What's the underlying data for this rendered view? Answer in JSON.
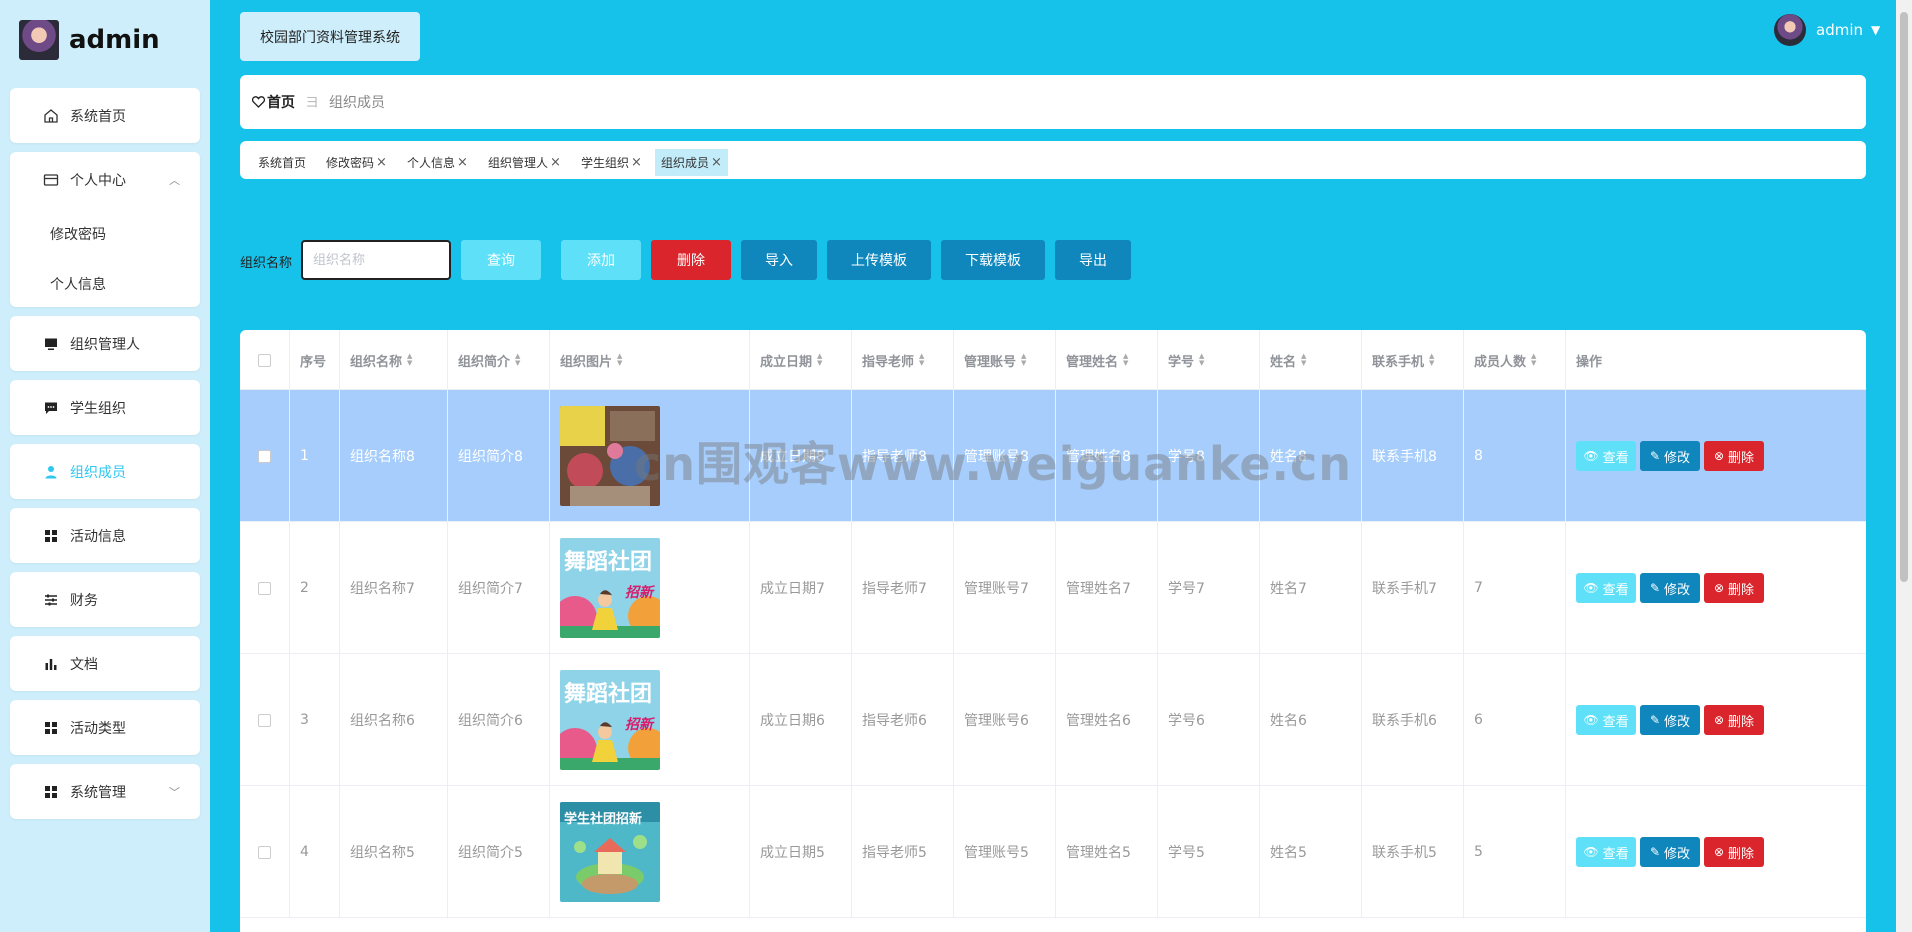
{
  "app": {
    "title": "校园部门资料管理系统",
    "brand": "admin",
    "user": "admin"
  },
  "sidebar": {
    "items": [
      {
        "label": "系统首页",
        "icon": "home-icon"
      },
      {
        "label": "个人中心",
        "icon": "card-icon",
        "children": [
          "修改密码",
          "个人信息"
        ]
      },
      {
        "label": "组织管理人",
        "icon": "monitor-icon"
      },
      {
        "label": "学生组织",
        "icon": "chat-icon"
      },
      {
        "label": "组织成员",
        "icon": "user-icon",
        "active": true
      },
      {
        "label": "活动信息",
        "icon": "grid-icon"
      },
      {
        "label": "财务",
        "icon": "sliders-icon"
      },
      {
        "label": "文档",
        "icon": "bar-chart-icon"
      },
      {
        "label": "活动类型",
        "icon": "grid-icon"
      },
      {
        "label": "系统管理",
        "icon": "grid-icon"
      }
    ]
  },
  "breadcrumb": {
    "home": "首页",
    "separator": "ヨ",
    "current": "组织成员"
  },
  "tags": [
    {
      "label": "系统首页",
      "closable": false
    },
    {
      "label": "修改密码",
      "closable": true
    },
    {
      "label": "个人信息",
      "closable": true
    },
    {
      "label": "组织管理人",
      "closable": true
    },
    {
      "label": "学生组织",
      "closable": true
    },
    {
      "label": "组织成员",
      "closable": true,
      "active": true
    }
  ],
  "search": {
    "label": "组织名称",
    "placeholder": "组织名称",
    "value": ""
  },
  "toolbar": {
    "query": "查询",
    "add": "添加",
    "delete": "删除",
    "import": "导入",
    "upload_template": "上传模板",
    "download_template": "下载模板",
    "export": "导出"
  },
  "colors": {
    "background": "#16c1ea",
    "sidebar": "#cdeefa",
    "light_button": "#5ee1f8",
    "danger": "#d9252b",
    "primary": "#0f87bd",
    "selected_row": "#a6cdfb",
    "active_menu": "#2ec7f0"
  },
  "table": {
    "columns": [
      "",
      "序号",
      "组织名称",
      "组织简介",
      "组织图片",
      "成立日期",
      "指导老师",
      "管理账号",
      "管理姓名",
      "学号",
      "姓名",
      "联系手机",
      "成员人数",
      "操作"
    ],
    "actions": {
      "view": "查看",
      "edit": "修改",
      "delete": "删除"
    },
    "rows": [
      {
        "index": "1",
        "name": "组织名称8",
        "intro": "组织简介8",
        "image": "crafts-photo",
        "date": "成立日期8",
        "teacher": "指导老师8",
        "account": "管理账号8",
        "manager": "管理姓名8",
        "student_no": "学号8",
        "person": "姓名8",
        "phone": "联系手机8",
        "members": "8",
        "selected": true,
        "thumb_text": ""
      },
      {
        "index": "2",
        "name": "组织名称7",
        "intro": "组织简介7",
        "image": "dance-poster",
        "date": "成立日期7",
        "teacher": "指导老师7",
        "account": "管理账号7",
        "manager": "管理姓名7",
        "student_no": "学号7",
        "person": "姓名7",
        "phone": "联系手机7",
        "members": "7",
        "thumb_text": "舞蹈社团",
        "thumb_sub": "招新"
      },
      {
        "index": "3",
        "name": "组织名称6",
        "intro": "组织简介6",
        "image": "dance-poster",
        "date": "成立日期6",
        "teacher": "指导老师6",
        "account": "管理账号6",
        "manager": "管理姓名6",
        "student_no": "学号6",
        "person": "姓名6",
        "phone": "联系手机6",
        "members": "6",
        "thumb_text": "舞蹈社团",
        "thumb_sub": "招新"
      },
      {
        "index": "4",
        "name": "组织名称5",
        "intro": "组织简介5",
        "image": "island-poster",
        "date": "成立日期5",
        "teacher": "指导老师5",
        "account": "管理账号5",
        "manager": "管理姓名5",
        "student_no": "学号5",
        "person": "姓名5",
        "phone": "联系手机5",
        "members": "5",
        "thumb_text": "学生社团招新"
      }
    ]
  },
  "watermark": "cn围观客www.weiguanke.cn"
}
